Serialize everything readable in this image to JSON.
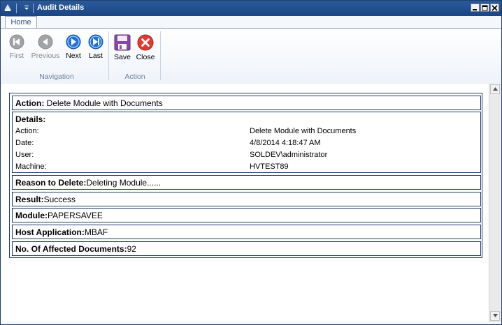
{
  "window": {
    "title": "Audit Details"
  },
  "ribbon": {
    "tabs": [
      {
        "label": "Home"
      }
    ],
    "groups": {
      "navigation": {
        "label": "Navigation",
        "buttons": {
          "first": {
            "label": "First",
            "icon": "first-icon",
            "enabled": false
          },
          "previous": {
            "label": "Previous",
            "icon": "previous-icon",
            "enabled": false
          },
          "next": {
            "label": "Next",
            "icon": "next-icon",
            "enabled": true
          },
          "last": {
            "label": "Last",
            "icon": "last-icon",
            "enabled": true
          }
        }
      },
      "action": {
        "label": "Action",
        "buttons": {
          "save": {
            "label": "Save",
            "icon": "save-icon"
          },
          "close": {
            "label": "Close",
            "icon": "close-icon"
          }
        }
      }
    }
  },
  "audit": {
    "action": {
      "label": "Action:",
      "value": " Delete Module with Documents"
    },
    "details": {
      "heading": "Details:",
      "rows": [
        {
          "key": "Action:",
          "value": "Delete Module with Documents"
        },
        {
          "key": "Date:",
          "value": "4/8/2014 4:18:47 AM"
        },
        {
          "key": "User:",
          "value": "SOLDEV\\administrator"
        },
        {
          "key": "Machine:",
          "value": "HVTEST89"
        }
      ]
    },
    "reason": {
      "label": "Reason to Delete:",
      "value": "Deleting Module......"
    },
    "result": {
      "label": "Result:",
      "value": "Success"
    },
    "module": {
      "label": "Module:",
      "value": "PAPERSAVEE"
    },
    "host": {
      "label": "Host Application:",
      "value": "MBAF"
    },
    "affected": {
      "label": "No. Of Affected Documents:",
      "value": "92"
    }
  },
  "colors": {
    "titlebar": "#1f4a89",
    "nav_enabled": "#1a6fd6",
    "nav_disabled": "#9a9a9a",
    "save": "#8e44ad",
    "close": "#e23a2e",
    "border": "#1e3d6a"
  }
}
